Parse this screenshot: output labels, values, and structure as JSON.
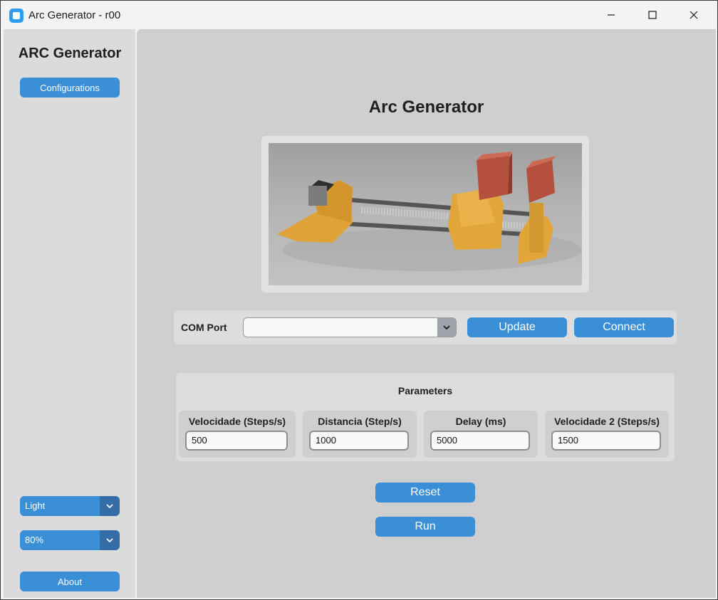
{
  "window": {
    "title": "Arc Generator - r00"
  },
  "sidebar": {
    "title": "ARC Generator",
    "configurations_label": "Configurations",
    "theme_select": {
      "value": "Light"
    },
    "scale_select": {
      "value": "80%"
    },
    "about_label": "About"
  },
  "main": {
    "title": "Arc Generator",
    "image_icon": "3d-render-linear-actuator",
    "com": {
      "label": "COM Port",
      "value": "",
      "update_label": "Update",
      "connect_label": "Connect"
    },
    "parameters": {
      "title": "Parameters",
      "fields": [
        {
          "label": "Velocidade (Steps/s)",
          "value": "500"
        },
        {
          "label": "Distancia (Step/s)",
          "value": "1000"
        },
        {
          "label": "Delay (ms)",
          "value": "5000"
        },
        {
          "label": "Velocidade 2 (Steps/s)",
          "value": "1500"
        }
      ]
    },
    "reset_label": "Reset",
    "run_label": "Run"
  },
  "colors": {
    "accent": "#3a8fd6",
    "accent_dark": "#346ea8",
    "sidebar_bg": "#dbdbdb",
    "main_bg": "#cfcfcf"
  }
}
